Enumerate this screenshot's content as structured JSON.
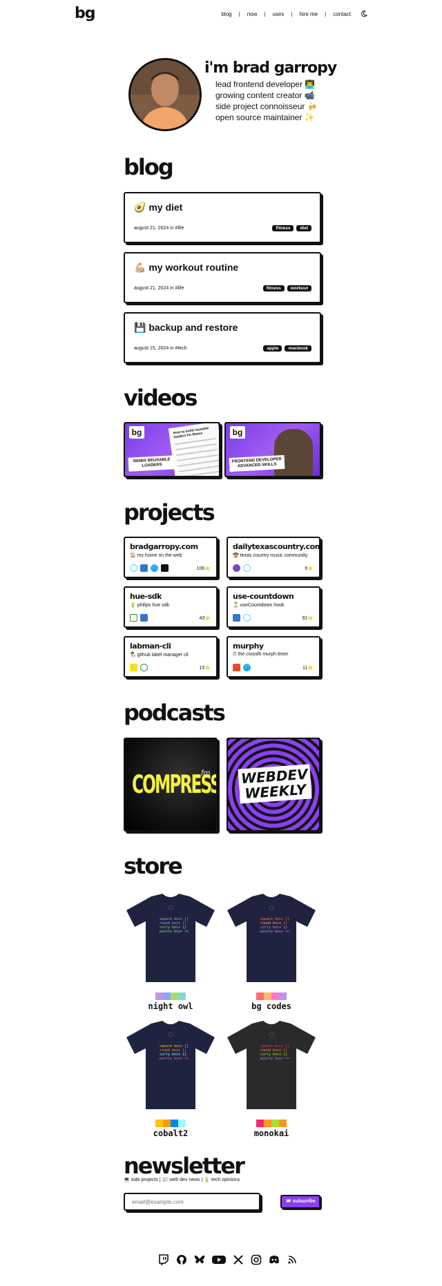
{
  "header": {
    "logo": "bg",
    "nav": [
      "blog",
      "now",
      "uses",
      "hire me",
      "contact"
    ],
    "separator": "|"
  },
  "hero": {
    "name": "i'm brad garropy",
    "lines": [
      "lead frontend developer 👨‍💻",
      "growing content creator 📹",
      "side project connoisseur 🍻",
      "open source maintainer ✨"
    ]
  },
  "blog": {
    "title": "blog",
    "posts": [
      {
        "title": "🥑 my diet",
        "meta": "august 21, 2024 in #life",
        "tags": [
          "fitness",
          "diet"
        ]
      },
      {
        "title": "💪🏼 my workout routine",
        "meta": "august 21, 2024 in #life",
        "tags": [
          "fitness",
          "workout"
        ]
      },
      {
        "title": "💾 backup and restore",
        "meta": "august 15, 2024 in #tech",
        "tags": [
          "apple",
          "macbook"
        ]
      }
    ]
  },
  "videos": {
    "title": "videos",
    "items": [
      {
        "label": "REMIX REUSABLE LOADERS",
        "doc_title": "How to build reusable loaders for Remix"
      },
      {
        "label": "FRONTEND DEVELOPER ADVANCED SKILLS"
      }
    ]
  },
  "projects": {
    "title": "projects",
    "items": [
      {
        "name": "bradgarropy.com",
        "desc": "🏠 my home on the web",
        "stars": "106⭐"
      },
      {
        "name": "dailytexascountry.com",
        "desc": "🤠 texas country music community",
        "stars": "6⭐"
      },
      {
        "name": "hue-sdk",
        "desc": "💡 philips hue sdk",
        "stars": "43⭐"
      },
      {
        "name": "use-countdown",
        "desc": "⏳ useCountdown hook",
        "stars": "91⭐"
      },
      {
        "name": "labman-cli",
        "desc": "👨‍🔬 github label manager cli",
        "stars": "15⭐"
      },
      {
        "name": "murphy",
        "desc": "⏱ the crossfit murph timer",
        "stars": "11⭐"
      }
    ]
  },
  "podcasts": {
    "title": "podcasts",
    "items": [
      {
        "text": "COMPRESSED",
        "suffix": "fm"
      },
      {
        "text": "WEBDEV WEEKLY"
      }
    ]
  },
  "store": {
    "title": "store",
    "shirt_lines": [
      "square bois []",
      "round bois ()",
      "curly bois {}",
      "pointy bois <>"
    ],
    "items": [
      {
        "name": "night owl",
        "shirt_color": "#1f2340",
        "swatches": [
          "#c792ea",
          "#82aaff",
          "#addb67",
          "#7fdbca"
        ],
        "text_colors": [
          "#c792ea",
          "#82aaff",
          "#addb67",
          "#7fdbca"
        ]
      },
      {
        "name": "bg codes",
        "shirt_color": "#1f2340",
        "swatches": [
          "#ff6b6b",
          "#ffb86c",
          "#ff79c6",
          "#bd93f9"
        ],
        "text_colors": [
          "#ff6b6b",
          "#ffb86c",
          "#ff79c6",
          "#bd93f9"
        ]
      },
      {
        "name": "cobalt2",
        "shirt_color": "#1f2340",
        "swatches": [
          "#ffc600",
          "#ff9d00",
          "#0088ff",
          "#9effff"
        ],
        "text_colors": [
          "#ffc600",
          "#ff9d00",
          "#9effff",
          "#ff628c"
        ]
      },
      {
        "name": "monokai",
        "shirt_color": "#2a2a2a",
        "swatches": [
          "#f92672",
          "#fd971f",
          "#a6e22e",
          "#fd971f"
        ],
        "text_colors": [
          "#f92672",
          "#fd971f",
          "#a6e22e",
          "#ae81ff"
        ]
      }
    ]
  },
  "newsletter": {
    "title": "newsletter",
    "subtitle": "💻 side projects | 📰 web dev news | 💡 tech opinions",
    "placeholder": "email@example.com",
    "button": "📨 subscribe"
  },
  "socials": [
    "twitch-icon",
    "github-icon",
    "bluesky-icon",
    "youtube-icon",
    "x-icon",
    "instagram-icon",
    "discord-icon",
    "rss-icon"
  ]
}
